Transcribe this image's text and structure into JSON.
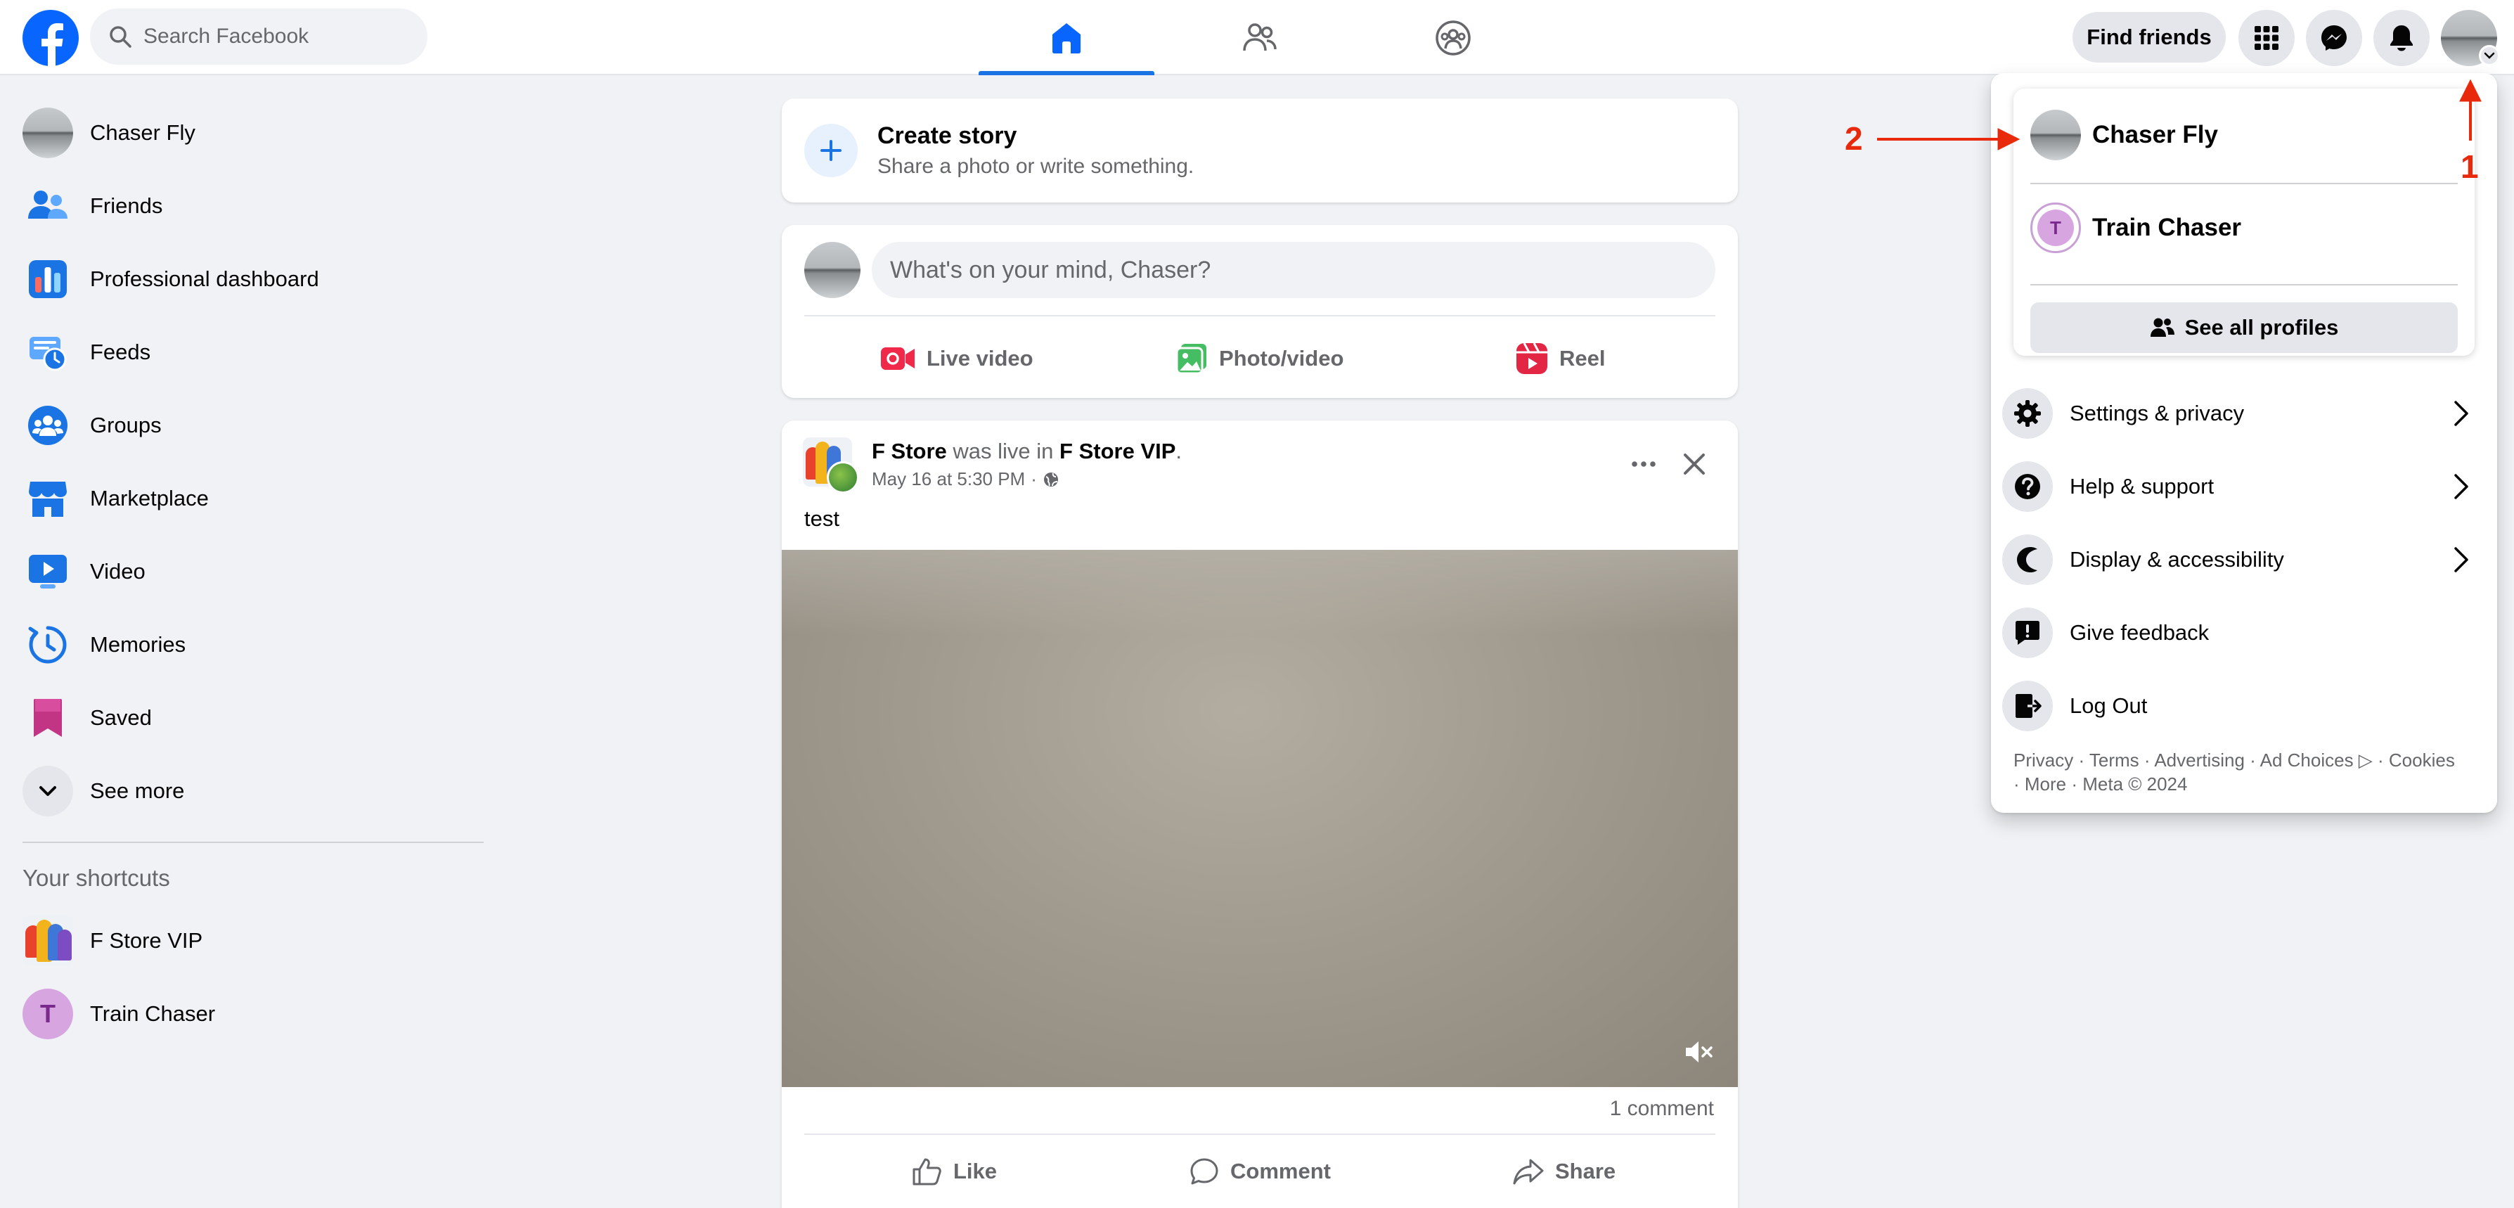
{
  "topbar": {
    "search_placeholder": "Search Facebook",
    "nav_tabs": [
      "home-icon",
      "friends-icon",
      "groups-icon"
    ],
    "active_tab": "home-icon",
    "find_friends": "Find friends"
  },
  "sidebar": {
    "items": [
      {
        "label": "Chaser Fly",
        "icon": "avatar"
      },
      {
        "label": "Friends",
        "icon": "friends-icon"
      },
      {
        "label": "Professional dashboard",
        "icon": "dashboard-icon"
      },
      {
        "label": "Feeds",
        "icon": "feeds-icon"
      },
      {
        "label": "Groups",
        "icon": "groups-icon"
      },
      {
        "label": "Marketplace",
        "icon": "marketplace-icon"
      },
      {
        "label": "Video",
        "icon": "video-icon"
      },
      {
        "label": "Memories",
        "icon": "memories-icon"
      },
      {
        "label": "Saved",
        "icon": "saved-icon"
      },
      {
        "label": "See more",
        "icon": "chevron-down-icon"
      }
    ],
    "shortcuts_title": "Your shortcuts",
    "shortcuts": [
      {
        "label": "F Store VIP",
        "icon": "group-image"
      },
      {
        "label": "Train Chaser",
        "initial": "T"
      }
    ]
  },
  "feed": {
    "story": {
      "title": "Create story",
      "subtitle": "Share a photo or write something."
    },
    "composer": {
      "placeholder": "What's on your mind, Chaser?",
      "actions": [
        {
          "label": "Live video",
          "icon": "live-video-icon",
          "color": "#f02849"
        },
        {
          "label": "Photo/video",
          "icon": "photo-icon",
          "color": "#45bd62"
        },
        {
          "label": "Reel",
          "icon": "reel-icon",
          "color": "#e42645"
        }
      ]
    },
    "post": {
      "author": "F Store",
      "verb": "was live in",
      "group": "F Store VIP",
      "date": "May 16 at 5:30 PM",
      "text": "test",
      "comments": "1 comment",
      "actions": [
        "Like",
        "Comment",
        "Share"
      ]
    }
  },
  "dropdown": {
    "profiles": [
      {
        "name": "Chaser Fly"
      },
      {
        "name": "Train Chaser",
        "initial": "T"
      }
    ],
    "see_all": "See all profiles",
    "menu": [
      {
        "label": "Settings & privacy",
        "icon": "gear-icon",
        "chevron": true
      },
      {
        "label": "Help & support",
        "icon": "help-icon",
        "chevron": true
      },
      {
        "label": "Display & accessibility",
        "icon": "moon-icon",
        "chevron": true
      },
      {
        "label": "Give feedback",
        "icon": "feedback-icon",
        "chevron": false
      },
      {
        "label": "Log Out",
        "icon": "logout-icon",
        "chevron": false
      }
    ],
    "footer_line1": "Privacy · Terms · Advertising · Ad Choices ▷ · Cookies",
    "footer_line2": "· More · Meta © 2024"
  },
  "annotations": {
    "one": "1",
    "two": "2",
    "color": "#e8290b"
  },
  "colors": {
    "brand": "#0866ff",
    "accent": "#1b74e4",
    "bg": "#f0f2f5"
  }
}
